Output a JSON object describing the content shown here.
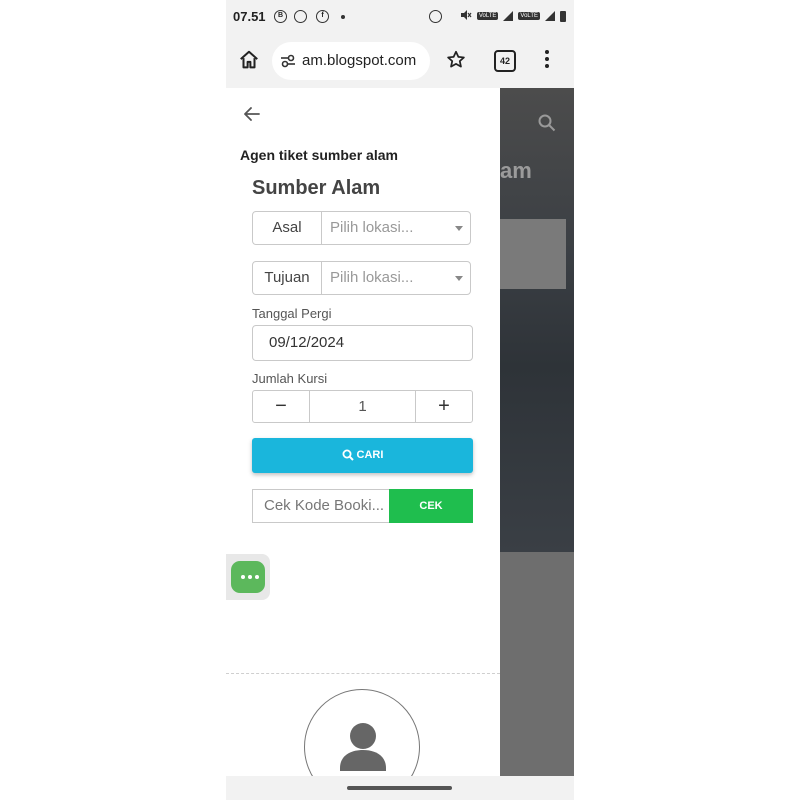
{
  "status_bar": {
    "time": "07.51",
    "icons": [
      "b-circle-icon",
      "whatsapp-icon",
      "facebook-icon",
      "dot-icon",
      "sync-icon",
      "mute-icon",
      "volte-icon",
      "signal-icon",
      "volte-icon",
      "signal-icon",
      "battery-icon"
    ],
    "volte_label": "VoLTE"
  },
  "browser": {
    "url": "am.blogspot.com",
    "tab_count": "42"
  },
  "drawer": {
    "title": "Agen tiket sumber alam"
  },
  "widget": {
    "title": "Sumber Alam",
    "origin": {
      "label": "Asal",
      "placeholder": "Pilih lokasi..."
    },
    "destination": {
      "label": "Tujuan",
      "placeholder": "Pilih lokasi..."
    },
    "date": {
      "label": "Tanggal Pergi",
      "value": "09/12/2024"
    },
    "seats": {
      "label": "Jumlah Kursi",
      "minus": "−",
      "value": "1",
      "plus": "+"
    },
    "search_button": "CARI",
    "booking": {
      "placeholder": "Cek Kode Booki...",
      "button": "CEK"
    }
  },
  "backdrop": {
    "heading_fragment": "am"
  },
  "colors": {
    "search_button": "#1ab6dc",
    "check_button": "#1fbe4e",
    "fab": "#5cb85c"
  }
}
